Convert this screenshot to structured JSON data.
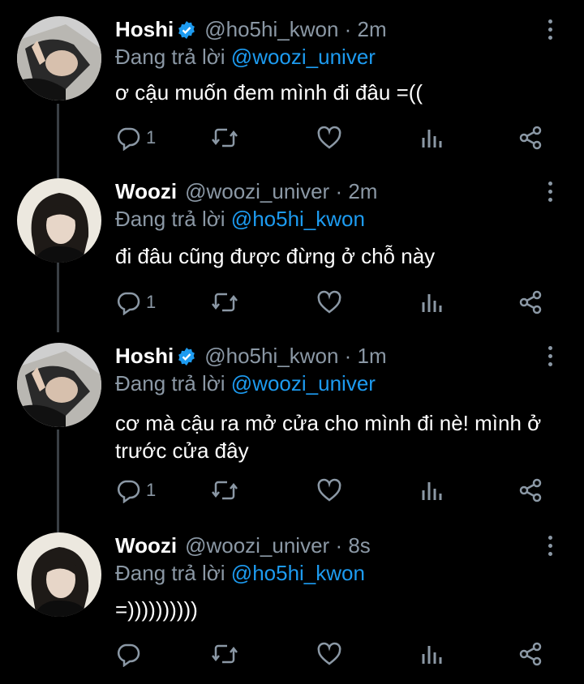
{
  "tweets": [
    {
      "name": "Hoshi",
      "verified": true,
      "handle": "@ho5hi_kwon",
      "time": "· 2m",
      "replying_prefix": "Đang trả lời",
      "replying_to": "@woozi_univer",
      "text": "ơ cậu muốn đem mình đi đâu =((",
      "reply_count": "1",
      "avatar": "hoshi-avatar"
    },
    {
      "name": "Woozi",
      "verified": false,
      "handle": "@woozi_univer",
      "time": "· 2m",
      "replying_prefix": "Đang trả lời",
      "replying_to": "@ho5hi_kwon",
      "text": "đi đâu cũng được đừng ở chỗ này",
      "reply_count": "1",
      "avatar": "woozi-avatar"
    },
    {
      "name": "Hoshi",
      "verified": true,
      "handle": "@ho5hi_kwon",
      "time": "· 1m",
      "replying_prefix": "Đang trả lời",
      "replying_to": "@woozi_univer",
      "text": "cơ mà cậu ra mở cửa cho mình đi nè! mình ở trước cửa đây",
      "reply_count": "1",
      "avatar": "hoshi-avatar"
    },
    {
      "name": "Woozi",
      "verified": false,
      "handle": "@woozi_univer",
      "time": "· 8s",
      "replying_prefix": "Đang trả lời",
      "replying_to": "@ho5hi_kwon",
      "text": "=))))))))))",
      "reply_count": "",
      "avatar": "woozi-avatar"
    }
  ],
  "icons": {
    "reply": "reply-icon",
    "retweet": "retweet-icon",
    "like": "heart-icon",
    "views": "analytics-icon",
    "share": "share-icon",
    "more": "more-vertical-icon",
    "verified": "verified-badge-icon"
  },
  "colors": {
    "background": "#000000",
    "text": "#ffffff",
    "muted": "#8b98a5",
    "link": "#1d9bf0"
  }
}
